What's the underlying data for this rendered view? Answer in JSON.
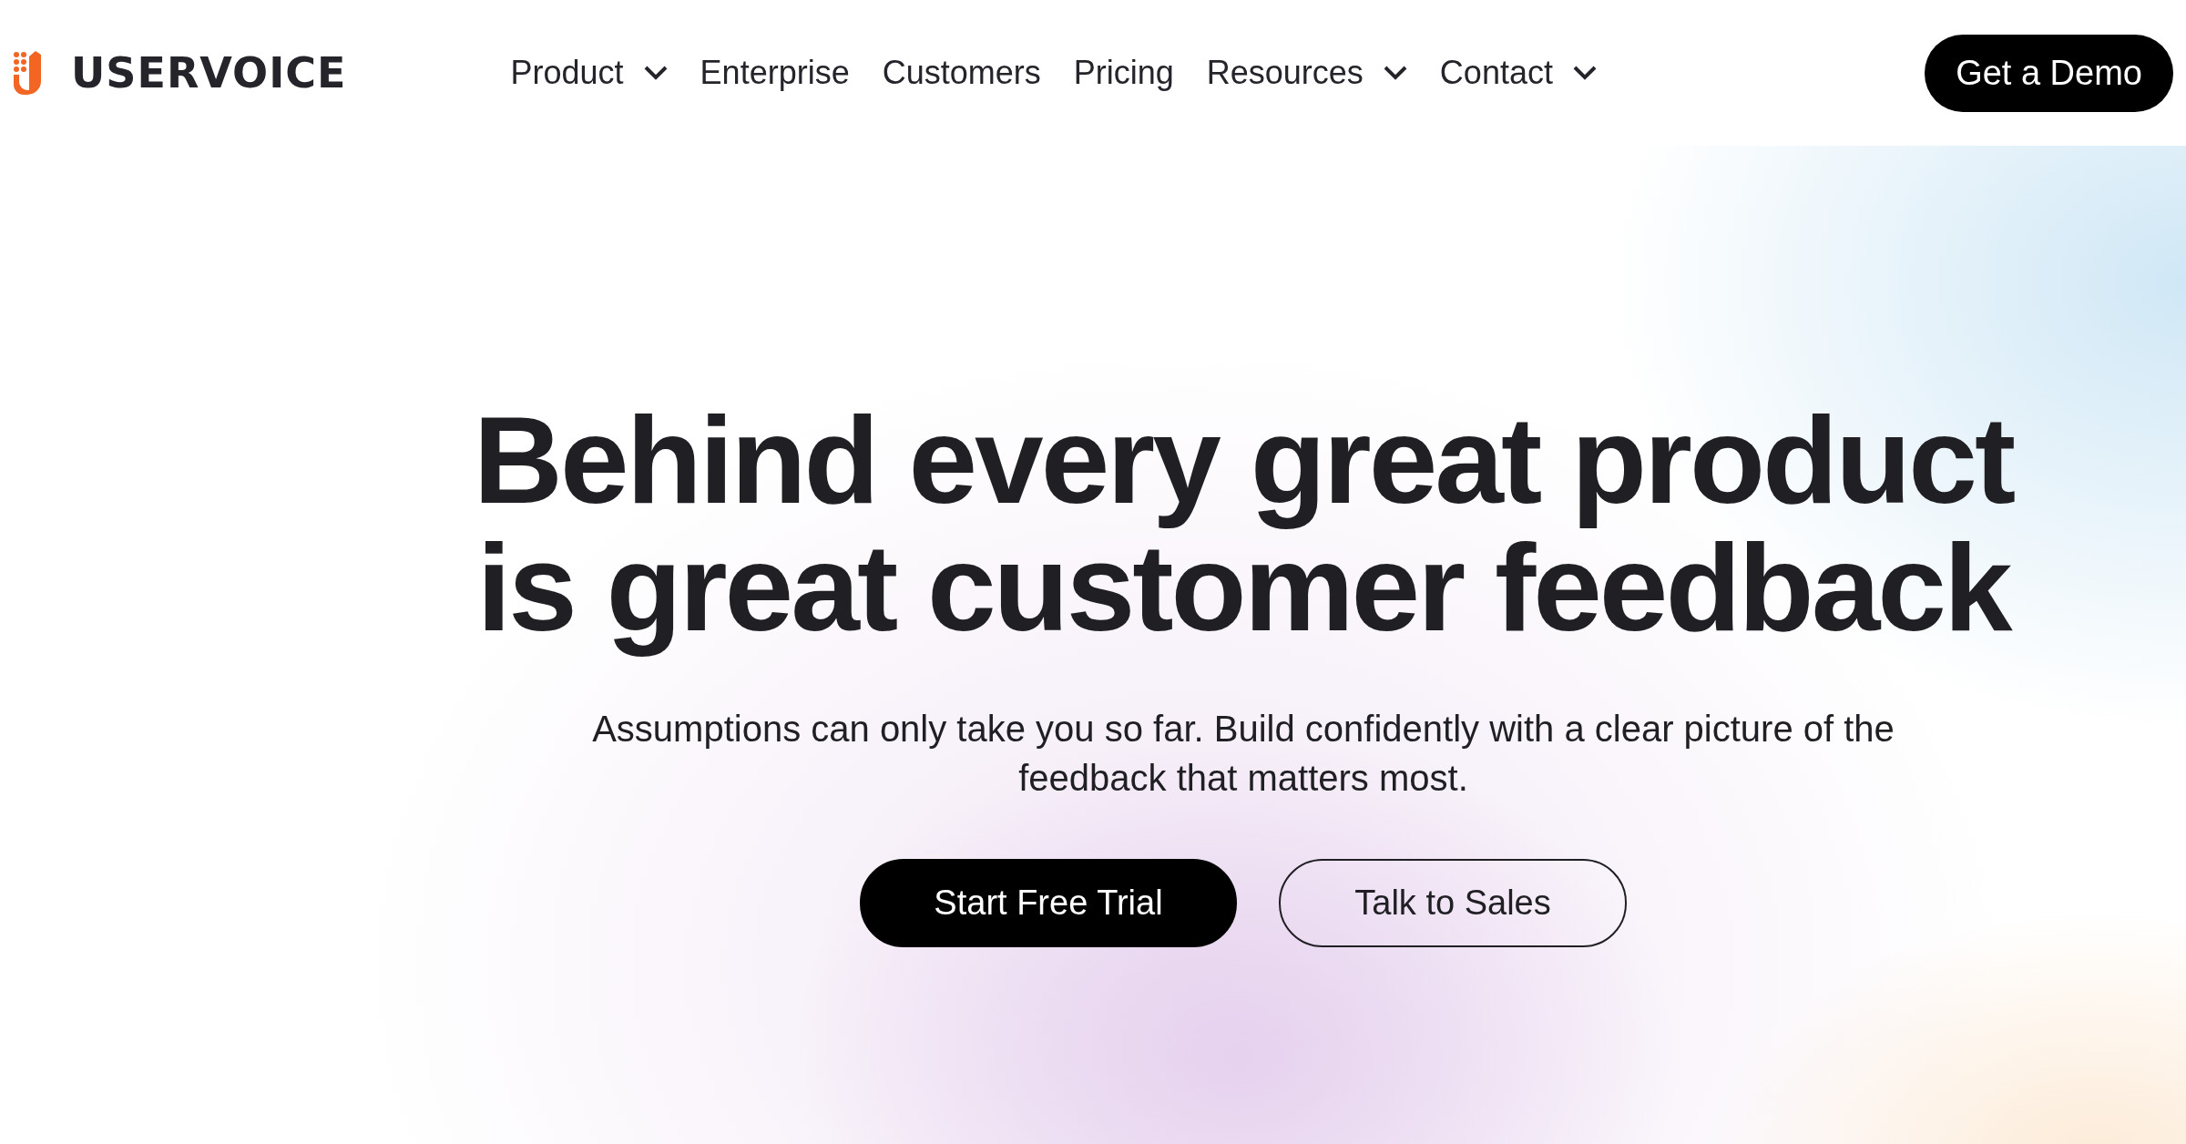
{
  "header": {
    "logo_text": "USERVOICE",
    "nav": [
      {
        "label": "Product",
        "has_dropdown": true
      },
      {
        "label": "Enterprise",
        "has_dropdown": false
      },
      {
        "label": "Customers",
        "has_dropdown": false
      },
      {
        "label": "Pricing",
        "has_dropdown": false
      },
      {
        "label": "Resources",
        "has_dropdown": true
      },
      {
        "label": "Contact",
        "has_dropdown": true
      }
    ],
    "cta": "Get a Demo"
  },
  "hero": {
    "headline_lines": [
      "Behind every great product",
      "is great customer feedback"
    ],
    "subtitle": "Assumptions can only take you so far. Build confidently with a clear picture of the feedback that matters most.",
    "buttons": [
      {
        "label": "Start Free Trial",
        "kind": "primary"
      },
      {
        "label": "Talk to Sales",
        "kind": "outline"
      }
    ]
  }
}
